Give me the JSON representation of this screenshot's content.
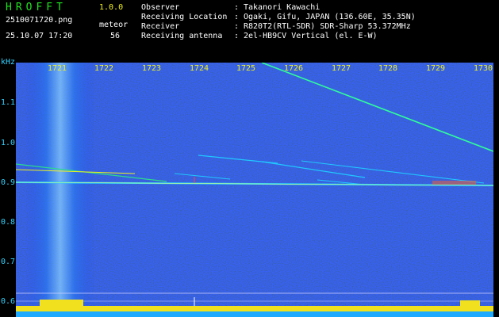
{
  "header": {
    "app_title": "HROFFT",
    "version": "1.0.0",
    "filename": "2510071720.png",
    "datetime": "25.10.07 17:20",
    "meteor_label": "meteor",
    "meteor_count": "56"
  },
  "info": {
    "rows": [
      {
        "label": "Observer",
        "sep": ":",
        "value": "Takanori Kawachi"
      },
      {
        "label": "Receiving Location",
        "sep": ":",
        "value": "Ogaki, Gifu, JAPAN (136.60E, 35.35N)"
      },
      {
        "label": "Receiver",
        "sep": ":",
        "value": "R820T2(RTL-SDR) SDR-Sharp 53.372MHz"
      },
      {
        "label": "Receiving antenna",
        "sep": ":",
        "value": "2el-HB9CV Vertical (el. E-W)"
      }
    ]
  },
  "axes": {
    "y_unit": "kHz",
    "y_ticks": [
      "1.1",
      "1.0",
      "0.9",
      "0.8",
      "0.7",
      "0.6"
    ],
    "x_ticks": [
      "1721",
      "1722",
      "1723",
      "1724",
      "1725",
      "1726",
      "1727",
      "1728",
      "1729",
      "1730"
    ]
  },
  "colors": {
    "green": "#1ee61e",
    "yellow": "#f0f01e",
    "cyan": "#32d2ff",
    "background": "#000000",
    "noise_blue": "#0a1ea0"
  }
}
